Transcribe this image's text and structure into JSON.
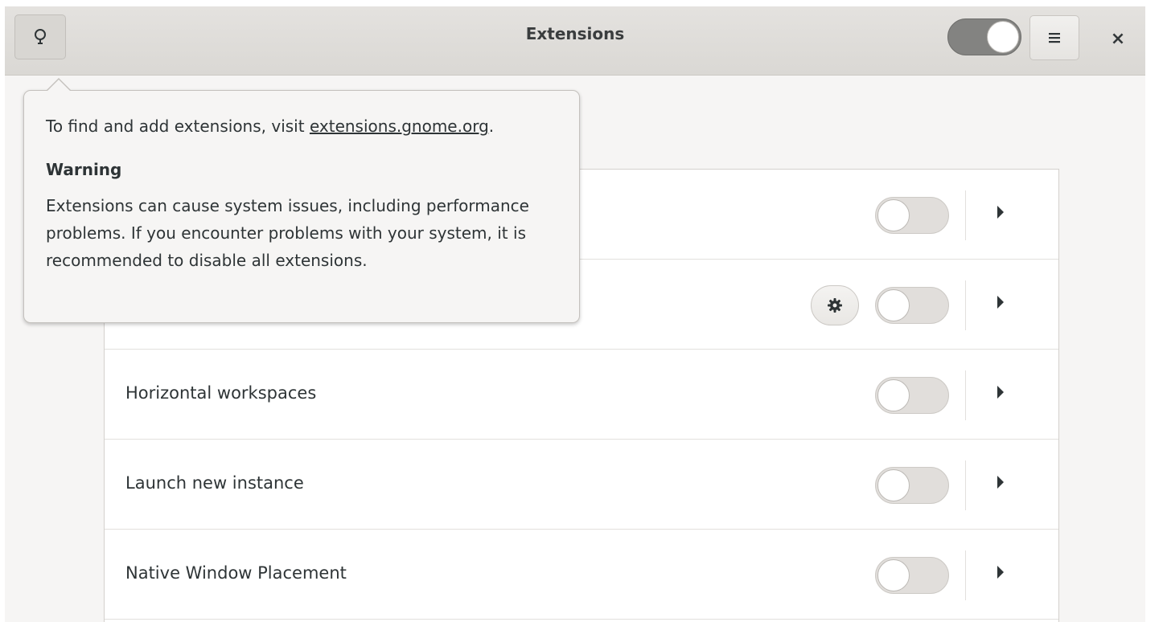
{
  "window": {
    "title": "Extensions",
    "extensions_enabled": false
  },
  "headerbar": {
    "tip_icon": "lightbulb-icon",
    "menu_icon": "hamburger-menu-icon",
    "close_label": "×"
  },
  "popover": {
    "intro_prefix": "To find and add extensions, visit ",
    "intro_link": "extensions.gnome.org",
    "intro_suffix": ".",
    "warning_heading": "Warning",
    "warning_body": "Extensions can cause system issues, including performance problems. If you encounter problems with your system, it is recommended to disable all extensions."
  },
  "extensions": [
    {
      "name": "",
      "enabled": false,
      "has_settings": false
    },
    {
      "name": "",
      "enabled": false,
      "has_settings": true
    },
    {
      "name": "Horizontal workspaces",
      "enabled": false,
      "has_settings": false
    },
    {
      "name": "Launch new instance",
      "enabled": false,
      "has_settings": false
    },
    {
      "name": "Native Window Placement",
      "enabled": false,
      "has_settings": false
    }
  ],
  "colors": {
    "headerbar_bg": "#dad8d4",
    "switch_on_track": "#838381",
    "switch_off_track": "#e1dedb",
    "list_bg": "#ffffff",
    "window_bg": "#f6f5f4"
  }
}
